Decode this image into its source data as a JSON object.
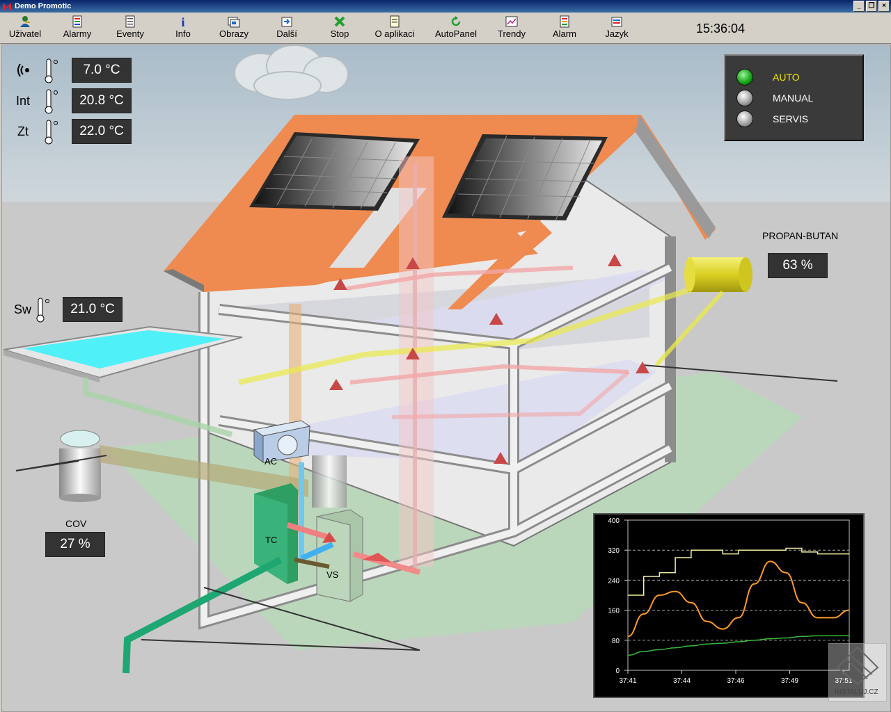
{
  "window": {
    "title": "Demo Promotic"
  },
  "toolbar": {
    "buttons": [
      {
        "label": "Uživatel",
        "icon": "user-key-icon"
      },
      {
        "label": "Alarmy",
        "icon": "alarms-list-icon"
      },
      {
        "label": "Eventy",
        "icon": "events-list-icon"
      },
      {
        "label": "Info",
        "icon": "info-icon"
      },
      {
        "label": "Obrazy",
        "icon": "screens-icon"
      },
      {
        "label": "Další",
        "icon": "next-screen-icon"
      },
      {
        "label": "Stop",
        "icon": "stop-x-icon"
      },
      {
        "label": "O aplikaci",
        "icon": "about-doc-icon"
      },
      {
        "label": "AutoPanel",
        "icon": "refresh-icon"
      },
      {
        "label": "Trendy",
        "icon": "trend-chart-icon"
      },
      {
        "label": "Alarm",
        "icon": "alarm-icon"
      },
      {
        "label": "Jazyk",
        "icon": "language-icon"
      }
    ],
    "clock": "15:36:04"
  },
  "temps": {
    "outdoor": {
      "value": "7.0 °C"
    },
    "int": {
      "label": "Int",
      "value": "20.8 °C"
    },
    "zt": {
      "label": "Zt",
      "value": "22.0 °C"
    },
    "sw": {
      "label": "Sw",
      "value": "21.0 °C"
    }
  },
  "modes": [
    {
      "label": "AUTO",
      "active": true,
      "color": "#f2e600"
    },
    {
      "label": "MANUAL",
      "active": false,
      "color": "#ffffff"
    },
    {
      "label": "SERVIS",
      "active": false,
      "color": "#ffffff"
    }
  ],
  "gas": {
    "label": "PROPAN-BUTAN",
    "value": "63 %"
  },
  "cov": {
    "label": "COV",
    "value": "27 %"
  },
  "equipment": {
    "ac": "AC",
    "tc": "TC",
    "vs": "VS"
  },
  "watermark": "INSTALUJ.CZ",
  "chart_data": {
    "type": "line",
    "x_ticks": [
      "37:41",
      "37:44",
      "37:46",
      "37:49",
      "37:51"
    ],
    "ylim": [
      0,
      400
    ],
    "y_ticks": [
      0,
      80,
      160,
      240,
      320,
      400
    ],
    "grid": "dashed horizontal",
    "series": [
      {
        "color": "#f2f2a0",
        "values": [
          200,
          250,
          260,
          300,
          320,
          320,
          310,
          320,
          320,
          320,
          325,
          315,
          310,
          310,
          310
        ]
      },
      {
        "color": "#ff9a2a",
        "values": [
          90,
          150,
          200,
          210,
          180,
          130,
          110,
          140,
          230,
          290,
          260,
          180,
          140,
          140,
          160
        ]
      },
      {
        "color": "#3ab83a",
        "values": [
          40,
          50,
          55,
          60,
          65,
          70,
          72,
          76,
          80,
          84,
          86,
          90,
          92,
          92,
          92
        ]
      }
    ]
  }
}
